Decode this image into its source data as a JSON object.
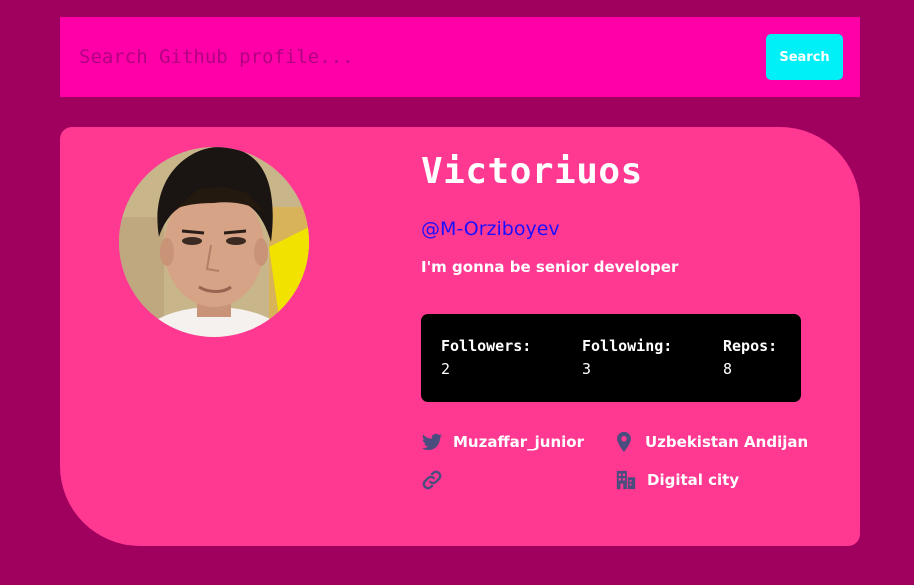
{
  "search": {
    "placeholder": "Search Github profile...",
    "button_label": "Search"
  },
  "profile": {
    "name": "Victoriuos",
    "username": "@M-Orziboyev",
    "bio": "I'm gonna be senior developer"
  },
  "stats": [
    {
      "label": "Followers:",
      "value": "2"
    },
    {
      "label": "Following:",
      "value": "3"
    },
    {
      "label": "Repos:",
      "value": "8"
    }
  ],
  "info": {
    "twitter": {
      "icon": "twitter-icon",
      "text": "Muzaffar_junior"
    },
    "location": {
      "icon": "location-pin-icon",
      "text": "Uzbekistan Andijan"
    },
    "website": {
      "icon": "link-icon",
      "text": ""
    },
    "company": {
      "icon": "building-icon",
      "text": "Digital city"
    }
  },
  "colors": {
    "page_background": "#a0005e",
    "search_background": "#ff00a8",
    "button_background": "#00f0f8",
    "card_background": "#ff3892",
    "username_color": "#1d10ff",
    "icon_color": "#4b4d7e",
    "stats_background": "#000000"
  }
}
